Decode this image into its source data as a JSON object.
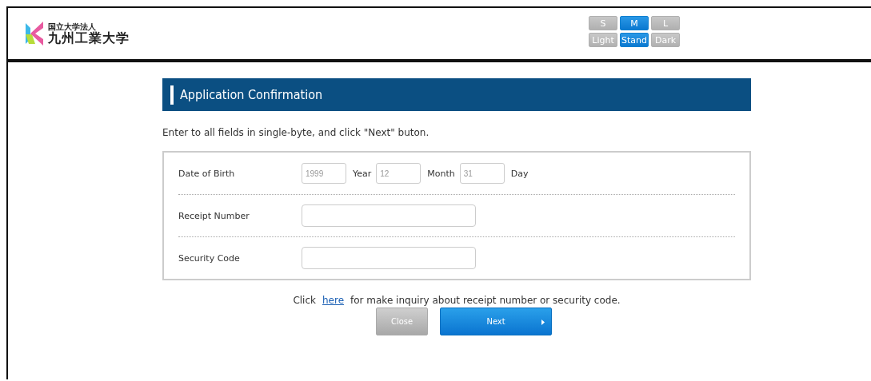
{
  "header": {
    "logo": {
      "subtitle": "国立大学法人",
      "name": "九州工業大学"
    },
    "font_sizes": [
      {
        "label": "S",
        "selected": false
      },
      {
        "label": "M",
        "selected": true
      },
      {
        "label": "L",
        "selected": false
      }
    ],
    "themes": [
      {
        "label": "Light",
        "selected": false
      },
      {
        "label": "Stand",
        "selected": true
      },
      {
        "label": "Dark",
        "selected": false
      }
    ]
  },
  "page": {
    "title": "Application Confirmation",
    "instruction": "Enter to all fields in single-byte, and click \"Next\" buton.",
    "form": {
      "date_of_birth": {
        "label": "Date of Birth",
        "parts": [
          {
            "placeholder": "1999",
            "unit": "Year"
          },
          {
            "placeholder": "12",
            "unit": "Month"
          },
          {
            "placeholder": "31",
            "unit": "Day"
          }
        ]
      },
      "fields": [
        {
          "label": "Receipt Number"
        },
        {
          "label": "Security Code"
        }
      ]
    },
    "inquiry": {
      "before": "Click",
      "link": "here",
      "after": "for make inquiry about receipt number or security code."
    },
    "buttons": [
      {
        "kind": "secondary",
        "label": "Close"
      },
      {
        "kind": "primary",
        "label": "Next"
      }
    ]
  }
}
